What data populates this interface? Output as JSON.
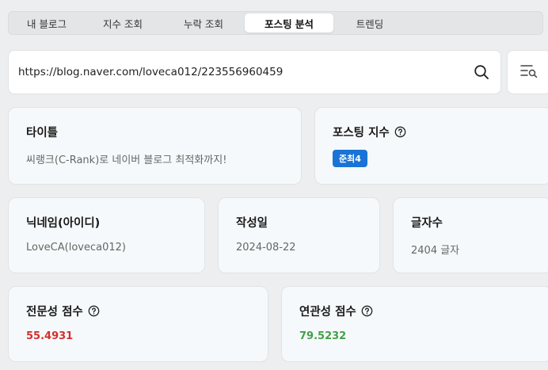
{
  "tabs": [
    {
      "label": "내 블로그"
    },
    {
      "label": "지수 조회"
    },
    {
      "label": "누락 조회"
    },
    {
      "label": "포스팅 분석"
    },
    {
      "label": "트렌딩"
    }
  ],
  "search": {
    "value": "https://blog.naver.com/loveca012/223556960459",
    "icon": "search-icon"
  },
  "filter": {
    "icon": "list-search-icon"
  },
  "cards": {
    "title": {
      "label": "타이틀",
      "value": "씨랭크(C-Rank)로 네이버 블로그 최적화까지!"
    },
    "posting_index": {
      "label": "포스팅 지수",
      "badge": "준최4"
    },
    "nickname": {
      "label": "닉네임(아이디)",
      "value": "LoveCA(loveca012)"
    },
    "date": {
      "label": "작성일",
      "value": "2024-08-22"
    },
    "chars": {
      "label": "글자수",
      "value": "2404 글자"
    },
    "expertise": {
      "label": "전문성 점수",
      "value": "55.4931"
    },
    "relevance": {
      "label": "연관성 점수",
      "value": "79.5232"
    }
  },
  "colors": {
    "badge": "#1a73d6",
    "expertise": "#d32f2f",
    "relevance": "#43a047"
  }
}
